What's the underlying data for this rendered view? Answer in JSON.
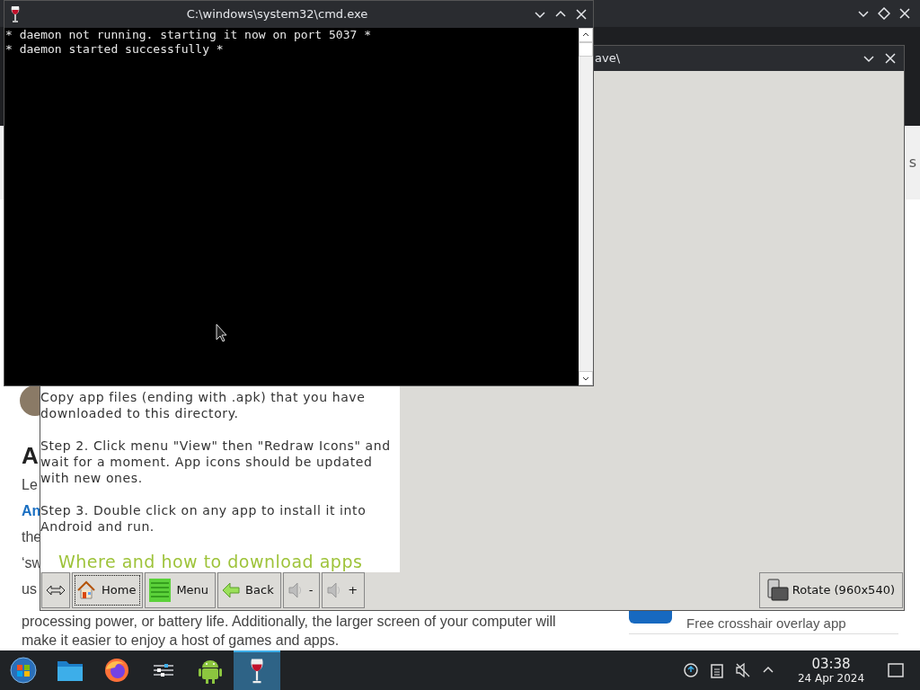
{
  "browser": {
    "sidebar_fragment": "s",
    "heading_fragment": "A",
    "paragraph_fragments": [
      {
        "text": "Le",
        "kind": "plain"
      },
      {
        "text": "An",
        "kind": "link"
      },
      {
        "text": "the",
        "kind": "plain"
      },
      {
        "text": "‘sw",
        "kind": "plain"
      },
      {
        "text": "us",
        "kind": "plain"
      }
    ],
    "lines": [
      "processing power, or battery life. Additionally, the larger screen of your computer will",
      "make it easier to enjoy a host of games and apps."
    ],
    "sidebar_item": "Free crosshair overlay app"
  },
  "emulator": {
    "title_fragment": "ave\\",
    "instructions": [
      "Copy app files (ending with .apk) that you have downloaded to this directory.",
      "Step 2. Click menu \"View\" then \"Redraw Icons\" and wait for a moment. App icons should be updated with new ones.",
      "Step 3. Double click on any app to install it into Android and run."
    ],
    "section_heading": "Where and how to download apps",
    "toolbar": [
      {
        "kind": "resize",
        "focused": false
      },
      {
        "kind": "home",
        "label": "Home",
        "focused": true
      },
      {
        "kind": "menu",
        "label": "Menu",
        "focused": false
      },
      {
        "kind": "back",
        "label": "Back",
        "focused": false
      },
      {
        "kind": "volume",
        "label": "-",
        "focused": false
      },
      {
        "kind": "volume",
        "label": "+",
        "focused": false
      }
    ],
    "rotate_button": "Rotate (960x540)"
  },
  "console": {
    "title": "C:\\windows\\system32\\cmd.exe",
    "lines": [
      "* daemon not running. starting it now on port 5037 *",
      "* daemon started successfully *"
    ]
  },
  "taskbar": {
    "apps": [
      {
        "kind": "start",
        "selected": false
      },
      {
        "kind": "folder",
        "selected": false
      },
      {
        "kind": "browser",
        "selected": false
      },
      {
        "kind": "mixer",
        "selected": false
      },
      {
        "kind": "android",
        "selected": false
      },
      {
        "kind": "wine",
        "selected": true
      }
    ],
    "clock": {
      "time": "03:38",
      "date": "24 Apr 2024"
    }
  }
}
